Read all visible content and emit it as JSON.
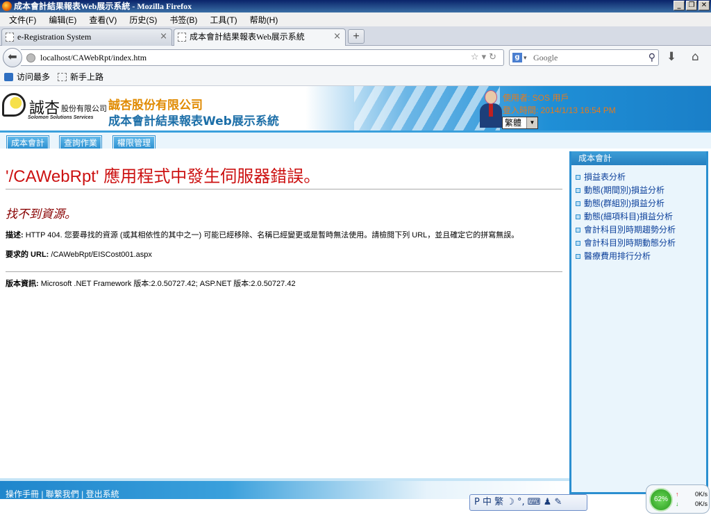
{
  "window": {
    "title": "成本會計結果報表Web展示系統 - Mozilla Firefox"
  },
  "menu": [
    "文件(F)",
    "编辑(E)",
    "查看(V)",
    "历史(S)",
    "书签(B)",
    "工具(T)",
    "帮助(H)"
  ],
  "tabs": [
    {
      "label": "e-Registration System",
      "close": "×"
    },
    {
      "label": "成本會計結果報表Web展示系統",
      "close": "×"
    }
  ],
  "newtab_label": "+",
  "address": {
    "url": "localhost/CAWebRpt/index.htm"
  },
  "search": {
    "placeholder": "Google"
  },
  "bookmarks": [
    "访问最多",
    "新手上路"
  ],
  "site": {
    "logo_big": "誠杏",
    "logo_small": "股份有限公司",
    "logo_en": "Solomon Solutions Services",
    "company_name": "誠杏股份有限公司",
    "system_name": "成本會計結果報表Web展示系統",
    "user_label": "使用者: SOS 用戶",
    "login_time": "登入時間: 2014/1/13 16:54 PM",
    "language": "繁體"
  },
  "nav_tabs": [
    "成本會計",
    "查詢作業",
    "權限管理"
  ],
  "error": {
    "title": "'/CAWebRpt' 應用程式中發生伺服器錯誤。",
    "subtitle": "找不到資源。",
    "desc_label": "描述:",
    "desc_text": "HTTP 404. 您要尋找的資源 (或其相依性的其中之一) 可能已經移除、名稱已經變更或是暫時無法使用。請檢閱下列 URL，並且確定它的拼寫無誤。",
    "url_label": "要求的 URL:",
    "url_value": "/CAWebRpt/EISCost001.aspx",
    "version_label": "版本資訊:",
    "version_text": "Microsoft .NET Framework 版本:2.0.50727.42; ASP.NET 版本:2.0.50727.42"
  },
  "sidebar": {
    "title": "成本會計",
    "items": [
      "損益表分析",
      "動態(期間別)損益分析",
      "動態(群組別)損益分析",
      "動態(細項科目)損益分析",
      "會計科目別時期趨勢分析",
      "會計科目別時期動態分析",
      "醫療費用排行分析"
    ]
  },
  "footer": {
    "links": "操作手冊 | 聯繫我們 | 登出系統"
  },
  "ime": {
    "text": "P 中 繁 ☽ °, ⌨ ♟ ✎"
  },
  "netmon": {
    "percent": "62%",
    "up_speed": "0K/s",
    "down_speed": "0K/s"
  }
}
